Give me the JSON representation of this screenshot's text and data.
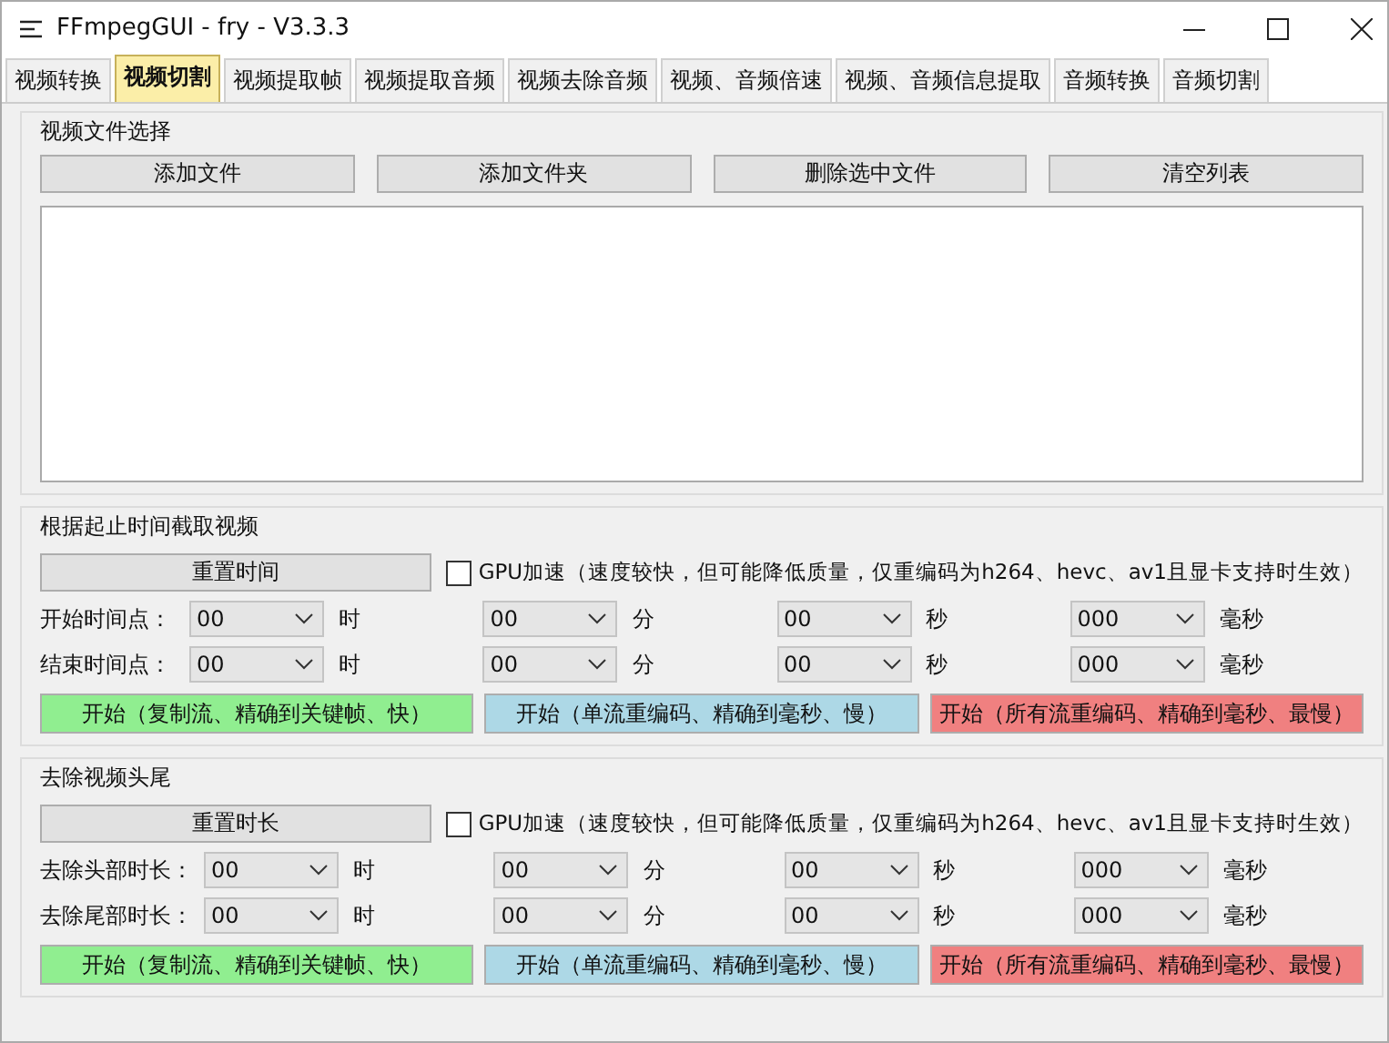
{
  "window": {
    "title": "FFmpegGUI - fry - V3.3.3"
  },
  "tabs": [
    {
      "label": "视频转换",
      "selected": false
    },
    {
      "label": "视频切割",
      "selected": true
    },
    {
      "label": "视频提取帧",
      "selected": false
    },
    {
      "label": "视频提取音频",
      "selected": false
    },
    {
      "label": "视频去除音频",
      "selected": false
    },
    {
      "label": "视频、音频倍速",
      "selected": false
    },
    {
      "label": "视频、音频信息提取",
      "selected": false
    },
    {
      "label": "音频转换",
      "selected": false
    },
    {
      "label": "音频切割",
      "selected": false
    }
  ],
  "file_section": {
    "title": "视频文件选择",
    "buttons": [
      "添加文件",
      "添加文件夹",
      "删除选中文件",
      "清空列表"
    ]
  },
  "time_sections": [
    {
      "title": "根据起止时间截取视频",
      "reset_button": "重置时间",
      "gpu": {
        "label": "GPU加速（速度较快，但可能降低质量，仅重编码为h264、hevc、av1且显卡支持时生效）",
        "checked": false
      },
      "rows": [
        {
          "label": "开始时间点：",
          "fields": [
            {
              "value": "00",
              "unit": "时"
            },
            {
              "value": "00",
              "unit": "分"
            },
            {
              "value": "00",
              "unit": "秒"
            },
            {
              "value": "000",
              "unit": "毫秒"
            }
          ]
        },
        {
          "label": "结束时间点：",
          "fields": [
            {
              "value": "00",
              "unit": "时"
            },
            {
              "value": "00",
              "unit": "分"
            },
            {
              "value": "00",
              "unit": "秒"
            },
            {
              "value": "000",
              "unit": "毫秒"
            }
          ]
        }
      ],
      "start_buttons": [
        {
          "label": "开始（复制流、精确到关键帧、快）",
          "color": "#90ee90"
        },
        {
          "label": "开始（单流重编码、精确到毫秒、慢）",
          "color": "#add8e6"
        },
        {
          "label": "开始（所有流重编码、精确到毫秒、最慢）",
          "color": "#f08080"
        }
      ]
    },
    {
      "title": "去除视频头尾",
      "reset_button": "重置时长",
      "gpu": {
        "label": "GPU加速（速度较快，但可能降低质量，仅重编码为h264、hevc、av1且显卡支持时生效）",
        "checked": false
      },
      "rows": [
        {
          "label": "去除头部时长：",
          "fields": [
            {
              "value": "00",
              "unit": "时"
            },
            {
              "value": "00",
              "unit": "分"
            },
            {
              "value": "00",
              "unit": "秒"
            },
            {
              "value": "000",
              "unit": "毫秒"
            }
          ]
        },
        {
          "label": "去除尾部时长：",
          "fields": [
            {
              "value": "00",
              "unit": "时"
            },
            {
              "value": "00",
              "unit": "分"
            },
            {
              "value": "00",
              "unit": "秒"
            },
            {
              "value": "000",
              "unit": "毫秒"
            }
          ]
        }
      ],
      "start_buttons": [
        {
          "label": "开始（复制流、精确到关键帧、快）",
          "color": "#90ee90"
        },
        {
          "label": "开始（单流重编码、精确到毫秒、慢）",
          "color": "#add8e6"
        },
        {
          "label": "开始（所有流重编码、精确到毫秒、最慢）",
          "color": "#f08080"
        }
      ]
    }
  ]
}
